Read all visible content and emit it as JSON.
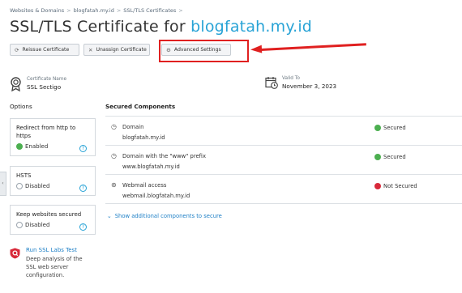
{
  "breadcrumb": {
    "items": [
      "Websites & Domains",
      "blogfatah.my.id",
      "SSL/TLS Certificates"
    ],
    "separator": ">"
  },
  "title": {
    "prefix": "SSL/TLS Certificate for ",
    "domain": "blogfatah.my.id"
  },
  "toolbar": {
    "reissue": {
      "label": "Reissue Certificate",
      "icon": "refresh-icon"
    },
    "unassign": {
      "label": "Unassign Certificate",
      "icon": "close-icon"
    },
    "advanced": {
      "label": "Advanced Settings",
      "icon": "gear-icon"
    }
  },
  "certificate": {
    "name_label": "Certificate Name",
    "name": "SSL Sectigo"
  },
  "validity": {
    "label": "Valid To",
    "date": "November 3, 2023"
  },
  "options": {
    "heading": "Options",
    "redirect": {
      "title": "Redirect from http to https",
      "status": "Enabled"
    },
    "hsts": {
      "title": "HSTS",
      "status": "Disabled"
    },
    "keep_secured": {
      "title": "Keep websites secured",
      "status": "Disabled"
    },
    "help_glyph": "?"
  },
  "secured_components": {
    "heading": "Secured Components",
    "rows": [
      {
        "name": "Domain",
        "host": "blogfatah.my.id",
        "status": "Secured",
        "icon": "globe-icon"
      },
      {
        "name": "Domain with the \"www\" prefix",
        "host": "www.blogfatah.my.id",
        "status": "Secured",
        "icon": "globe-icon"
      },
      {
        "name": "Webmail access",
        "host": "webmail.blogfatah.my.id",
        "status": "Not Secured",
        "icon": "webmail-icon"
      }
    ],
    "show_more": "Show additional components to secure"
  },
  "ssl_test": {
    "link": "Run SSL Labs Test",
    "description": "Deep analysis of the SSL web server configuration."
  },
  "sidebar_toggle": "‹",
  "colors": {
    "accent": "#28a3d6",
    "link": "#1d7fc6",
    "success": "#4caf50",
    "danger": "#d8293a",
    "annotation": "#e02020"
  }
}
